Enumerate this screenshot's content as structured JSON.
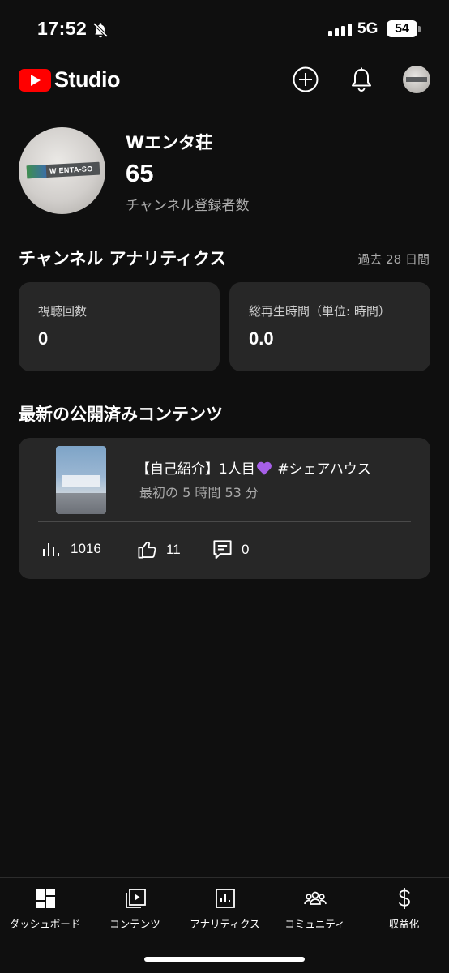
{
  "status_bar": {
    "time": "17:52",
    "network": "5G",
    "battery": "54",
    "icons": [
      "bell-slash-icon",
      "signal-icon",
      "battery-icon"
    ]
  },
  "header": {
    "logo_text": "Studio",
    "brand_color": "#ff0000",
    "icons": [
      "create-plus-icon",
      "notifications-bell-icon",
      "account-avatar"
    ]
  },
  "channel": {
    "name": "Wエンタ荘",
    "subscribers": "65",
    "subscribers_label": "チャンネル登録者数",
    "avatar_sign_text": "W ENTA-SO"
  },
  "analytics": {
    "title": "チャンネル アナリティクス",
    "period": "過去 28 日間",
    "metrics": [
      {
        "label": "視聴回数",
        "value": "0"
      },
      {
        "label": "総再生時間（単位: 時間）",
        "value": "0.0"
      }
    ]
  },
  "latest": {
    "title": "最新の公開済みコンテンツ",
    "video": {
      "title_before": "【自己紹介】1人目",
      "title_after": " #シェアハウス",
      "subtitle": "最初の 5 時間 53 分",
      "views": "1016",
      "likes": "11",
      "comments": "0"
    }
  },
  "bottom_nav": [
    {
      "label": "ダッシュボード",
      "icon": "dashboard-icon",
      "active": true
    },
    {
      "label": "コンテンツ",
      "icon": "content-icon"
    },
    {
      "label": "アナリティクス",
      "icon": "analytics-icon"
    },
    {
      "label": "コミュニティ",
      "icon": "community-icon"
    },
    {
      "label": "収益化",
      "icon": "dollar-icon"
    }
  ]
}
